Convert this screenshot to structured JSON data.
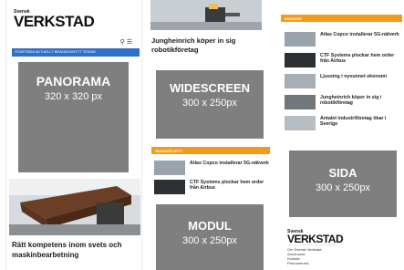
{
  "column_left": {
    "brand_small": "Svensk",
    "brand_big": "VERKSTAD",
    "nav_items": "STARTSIDA  AKTUELLT  BRANSCHNYTT  TEKNIK",
    "icons": [
      "search-icon",
      "menu-icon"
    ],
    "ad": {
      "title": "PANORAMA",
      "size": "320 x 320 px"
    },
    "headline": "Rätt kompetens inom svets och maskinbearbetning"
  },
  "column_middle": {
    "headline": "Jungheinrich köper in sig robotikföretag",
    "ad_widescreen": {
      "title": "WIDESCREEN",
      "size": "300 x 250px"
    },
    "section_label": "SENASTE NYTT",
    "items": [
      "Atlas Copco installerar 5G-nätverk",
      "CTF Systems plockar hem order från Airbus"
    ],
    "ad_modul": {
      "title": "MODUL",
      "size": "300 x 250px"
    }
  },
  "column_right": {
    "section_label": "SENASTE",
    "items": [
      "Atlas Copco installerar 5G-nätverk",
      "CTF Systems plockar hem order från Airbus",
      "Ljussing i nyvunnet ekonomi",
      "Jungheinrich köper in sig i robotikföretag",
      "Antalet industriföretag ökar i Sverige"
    ],
    "ad_sida": {
      "title": "SIDA",
      "size": "300 x 250px"
    },
    "footer_brand_small": "Svensk",
    "footer_brand_big": "VERKSTAD",
    "footer_links": [
      "Om Svensk Verkstad",
      "Annonsera",
      "Kontakt",
      "Prenumerera"
    ]
  },
  "colors": {
    "nav_blue": "#2f6fc5",
    "accent_orange": "#f29a1b",
    "ad_gray": "#7f7f7f"
  }
}
